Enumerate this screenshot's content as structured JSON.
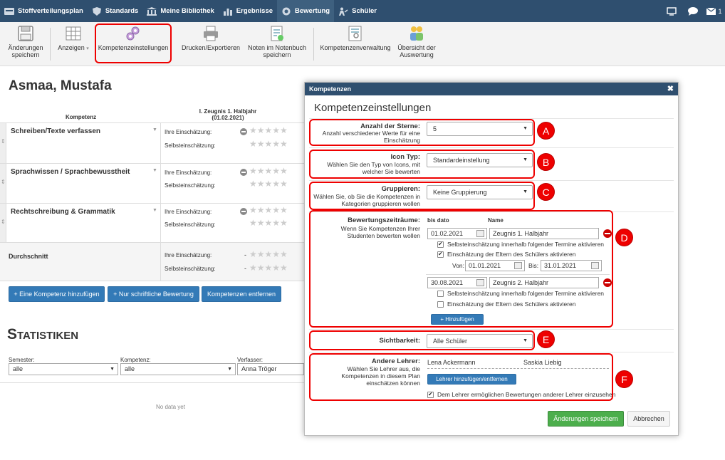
{
  "nav": {
    "items": [
      {
        "label": "Stoffverteilungsplan",
        "icon": "plan-icon"
      },
      {
        "label": "Standards",
        "icon": "shield-icon"
      },
      {
        "label": "Meine Bibliothek",
        "icon": "library-icon"
      },
      {
        "label": "Ergebnisse",
        "icon": "chart-icon"
      },
      {
        "label": "Bewertung",
        "icon": "rating-icon"
      },
      {
        "label": "Schüler",
        "icon": "students-icon"
      }
    ],
    "active_index": 4,
    "mail_count": "1"
  },
  "toolbar": {
    "save": "Änderungen speichern",
    "view": "Anzeigen",
    "settings": "Kompetenzeinstellungen",
    "print": "Drucken/Exportieren",
    "grades": "Noten im Notenbuch speichern",
    "manage": "Kompetenzenverwaltung",
    "overview": "Übersicht der Auswertung"
  },
  "student": {
    "name": "Asmaa, Mustafa"
  },
  "table": {
    "col_competence": "Kompetenz",
    "col_report_line1": "I. Zeugnis 1. Halbjahr",
    "col_report_line2": "(01.02.2021)",
    "own_label": "Ihre Einschätzung:",
    "self_label": "Selbsteinschätzung:",
    "competences": [
      "Schreiben/Texte verfassen",
      "Sprachwissen / Sprachbewusstheit",
      "Rechtschreibung & Grammatik"
    ],
    "average": "Durchschnitt",
    "dash": "-"
  },
  "buttons": {
    "add_competence": "+ Eine Kompetenz hinzufügen",
    "written_only": "+ Nur schriftliche Bewertung",
    "remove": "Kompetenzen entfernen"
  },
  "stats": {
    "title": "Statistiken",
    "semester_label": "Semester:",
    "semester_value": "alle",
    "competence_label": "Kompetenz:",
    "competence_value": "alle",
    "author_label": "Verfasser:",
    "author_value": "Anna Tröger",
    "no_data": "No data yet"
  },
  "modal": {
    "header": "Kompetenzen",
    "title": "Kompetenzeinstellungen",
    "stars_label": "Anzahl der Sterne:",
    "stars_desc": "Anzahl verschiedener Werte für eine Einschätzung",
    "stars_value": "5",
    "icon_label": "Icon Typ:",
    "icon_desc": "Wählen Sie den Typ von Icons, mit welcher Sie bewerten",
    "icon_value": "Standardeinstellung",
    "group_label": "Gruppieren:",
    "group_desc": "Wählen Sie, ob Sie die Kompetenzen in Kategorien gruppieren wollen",
    "group_value": "Keine Gruppierung",
    "period_label": "Bewertungszeiträume:",
    "period_desc": "Wenn Sie Kompetenzen Ihrer Studenten bewerten wollen",
    "col_date": "bis dato",
    "col_name": "Name",
    "period1_date": "01.02.2021",
    "period1_name": "Zeugnis 1. Halbjahr",
    "self_assess": "Selbsteinschätzung innerhalb folgender Termine aktivieren",
    "parents_assess": "Einschätzung der Eltern des Schülers aktivieren",
    "from_label": "Von:",
    "from_value": "01.01.2021",
    "to_label": "Bis:",
    "to_value": "31.01.2021",
    "period2_date": "30.08.2021",
    "period2_name": "Zeugnis 2. Halbjahr",
    "add_btn": "+ Hinzufügen",
    "visibility_label": "Sichtbarkeit:",
    "visibility_value": "Alle Schüler",
    "teachers_label": "Andere Lehrer:",
    "teachers_desc": "Wählen Sie Lehrer aus, die Kompetenzen in diesem Plan einschätzen können",
    "teacher1": "Lena Ackermann",
    "teacher2": "Saskia Liebig",
    "teachers_btn": "Lehrer hinzufügen/entfernen",
    "teachers_allow": "Dem Lehrer ermöglichen Bewertungen anderer Lehrer einzusehen",
    "save_btn": "Änderungen speichern",
    "cancel_btn": "Abbrechen"
  },
  "badges": [
    "A",
    "B",
    "C",
    "D",
    "E",
    "F"
  ],
  "colors": {
    "nav": "#2f4f6f",
    "accent": "#337ab7",
    "highlight": "#e00000",
    "save": "#4cae4c"
  }
}
